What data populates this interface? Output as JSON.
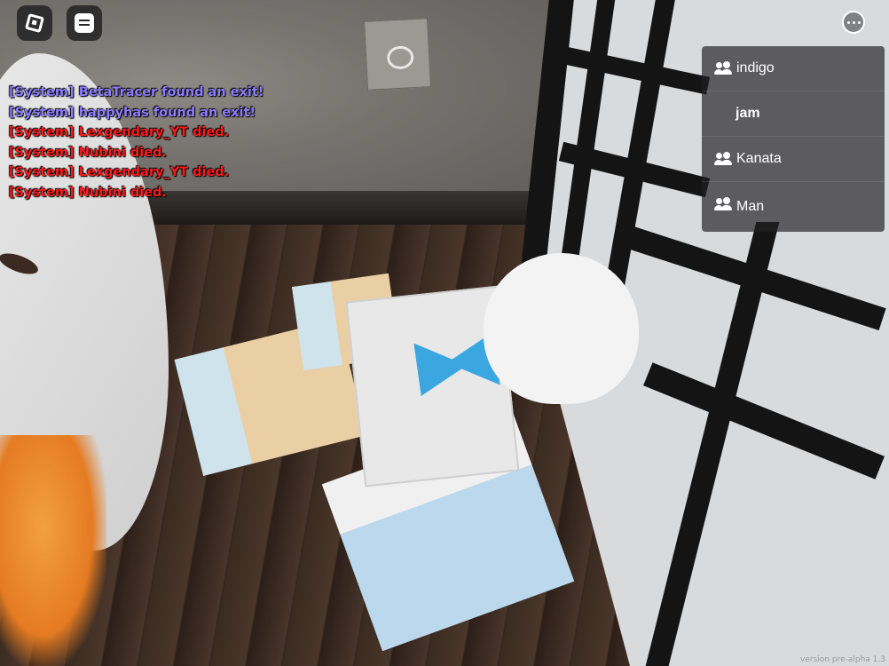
{
  "chat": {
    "lines": [
      {
        "text": "[System] BetaTracer found an exit!",
        "color": "#8f7cff"
      },
      {
        "text": "[System] happyhas found an exit!",
        "color": "#8f7cff"
      },
      {
        "text": "[System] Lexgendary_YT died.",
        "color": "#ff1a1a"
      },
      {
        "text": "[System] Nubini died.",
        "color": "#ff1a1a"
      },
      {
        "text": "[System] Lexgendary_YT died.",
        "color": "#ff1a1a"
      },
      {
        "text": "[System] Nubini died.",
        "color": "#ff1a1a"
      }
    ]
  },
  "topbar": {
    "menu_icon": "roblox-logo-icon",
    "chat_icon": "chat-icon",
    "more_icon": "more-options-icon"
  },
  "playerlist": {
    "players": [
      {
        "name": "indigo",
        "friend": true
      },
      {
        "name": "jam",
        "friend": false
      },
      {
        "name": "Kanata",
        "friend": true
      },
      {
        "name": "Man",
        "friend": true
      }
    ]
  },
  "version": "version pre-alpha 1.3"
}
